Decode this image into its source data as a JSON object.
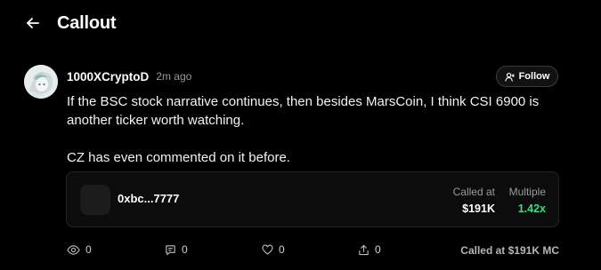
{
  "header": {
    "title": "Callout"
  },
  "post": {
    "author": "1000XCryptoD",
    "time": "2m ago",
    "follow_label": "Follow",
    "body": [
      "If the BSC stock narrative continues, then besides MarsCoin, I think CSI 6900 is another ticker worth watching.",
      "CZ has even commented on it before."
    ]
  },
  "token_card": {
    "address": "0xbc...7777",
    "called_at_label": "Called at",
    "called_at_value": "$191K",
    "multiple_label": "Multiple",
    "multiple_value": "1.42x",
    "multiple_color": "#3ddc84"
  },
  "actions": {
    "views": "0",
    "comments": "0",
    "likes": "0",
    "shares": "0",
    "footer_note": "Called at $191K MC"
  },
  "icons": {
    "back": "arrow-left-icon",
    "follow": "user-icon",
    "views": "eye-icon",
    "comments": "comment-icon",
    "likes": "heart-icon",
    "shares": "share-icon"
  }
}
